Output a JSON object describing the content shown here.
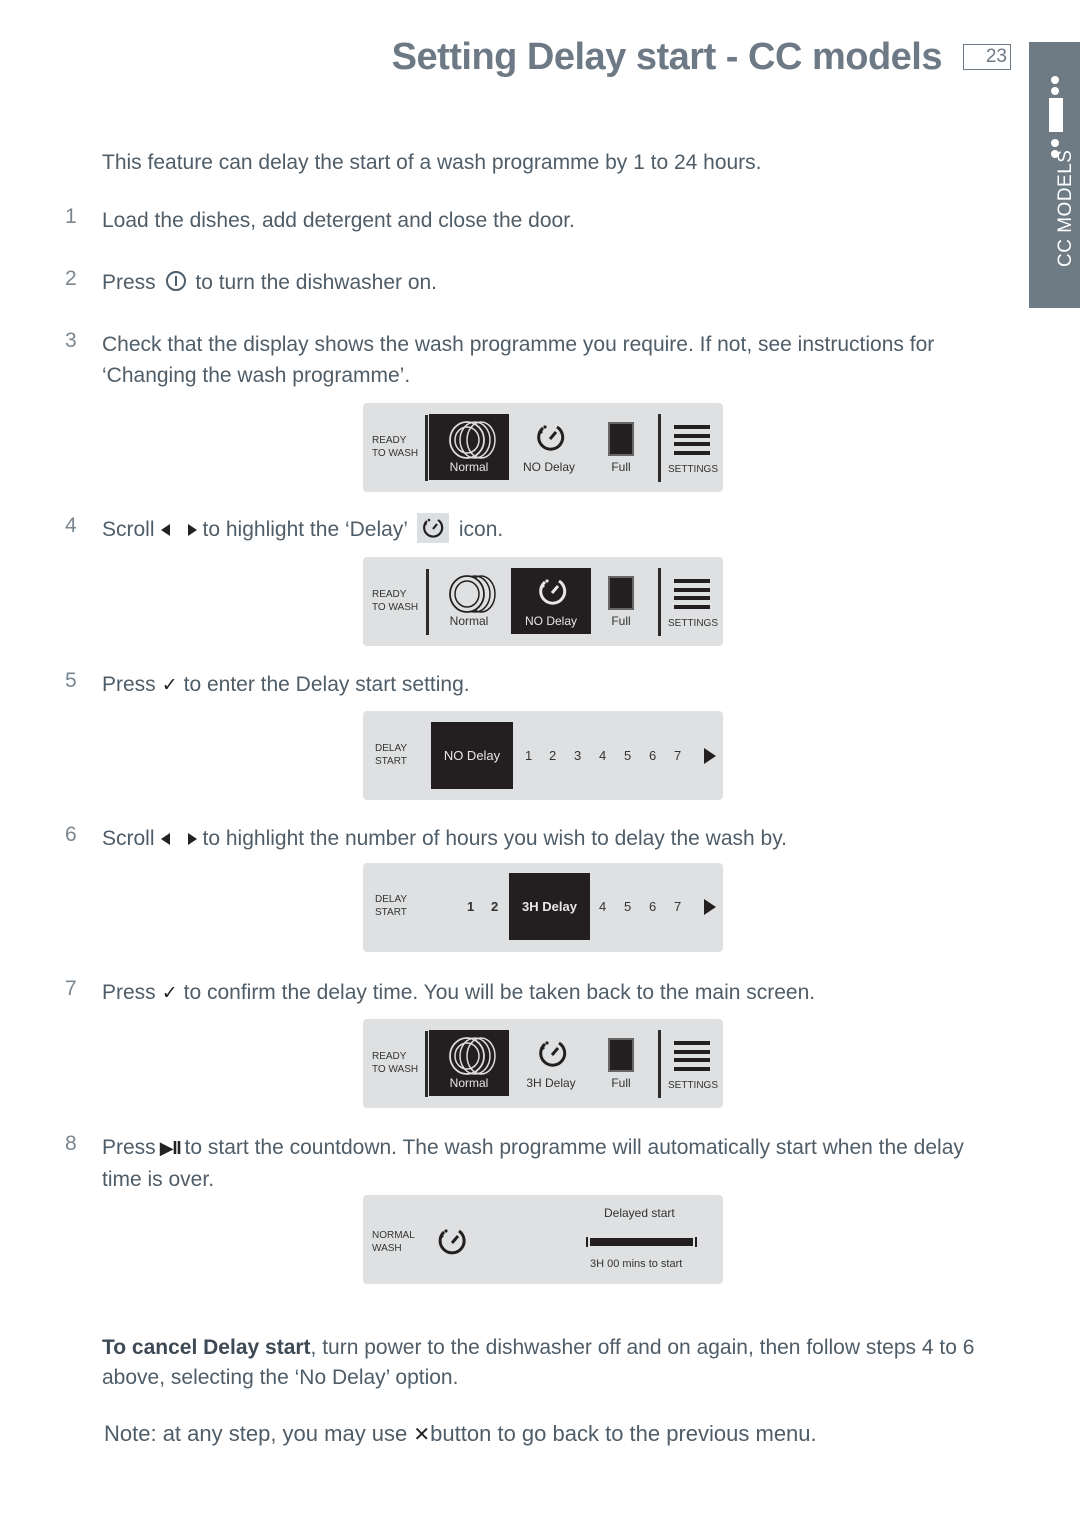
{
  "header": {
    "title": "Setting Delay start  - CC models",
    "page_number": "23",
    "side_tab_label": "CC MODELS"
  },
  "intro": "This feature can delay the start of a wash programme by 1 to 24 hours.",
  "steps": [
    {
      "num": "1",
      "text": "Load the dishes, add detergent and close the door."
    },
    {
      "num": "2",
      "before": "Press",
      "icon": "power-icon",
      "after": "to turn the dishwasher on."
    },
    {
      "num": "3",
      "text": "Check that the display shows the wash programme you require. If not, see instructions for",
      "text2": "‘Changing the wash programme’."
    },
    {
      "num": "4",
      "before": "Scroll",
      "icon": "left-right-arrows-icon",
      "after": "to highlight the ‘Delay’",
      "icon2": "delay-dial-icon",
      "after2": "icon."
    },
    {
      "num": "5",
      "before": "Press",
      "icon": "check-icon",
      "after": "to enter the Delay start setting."
    },
    {
      "num": "6",
      "before": "Scroll",
      "icon": "left-right-arrows-icon",
      "after": "to highlight the number of hours you wish to delay the wash by."
    },
    {
      "num": "7",
      "before": "Press",
      "icon": "check-icon",
      "after": "to confirm the delay time. You will be taken back to the main screen."
    },
    {
      "num": "8",
      "before": "Press",
      "icon": "play-pause-icon",
      "after": "to start the countdown. The wash programme will automatically start when the delay",
      "text2": "time is over."
    }
  ],
  "icons": {
    "check": "✓",
    "play_pause": "▶II",
    "x": "✕"
  },
  "panels": {
    "main1": {
      "status": [
        "READY",
        "TO WASH"
      ],
      "tiles": [
        "Normal",
        "NO Delay",
        "Full"
      ],
      "selected": "Normal",
      "settings": "SETTINGS"
    },
    "main2": {
      "status": [
        "READY",
        "TO WASH"
      ],
      "tiles": [
        "Normal",
        "NO Delay",
        "Full"
      ],
      "selected": "NO Delay",
      "settings": "SETTINGS"
    },
    "delay1": {
      "status": [
        "DELAY",
        "START"
      ],
      "selected": "NO Delay",
      "numbers": [
        "1",
        "2",
        "3",
        "4",
        "5",
        "6",
        "7"
      ]
    },
    "delay2": {
      "status": [
        "DELAY",
        "START"
      ],
      "before": [
        "1",
        "2"
      ],
      "selected": "3H Delay",
      "after": [
        "4",
        "5",
        "6",
        "7"
      ]
    },
    "main3": {
      "status": [
        "READY",
        "TO WASH"
      ],
      "tiles": [
        "Normal",
        "3H Delay",
        "Full"
      ],
      "selected": "Normal",
      "settings": "SETTINGS"
    },
    "countdown": {
      "status": [
        "NORMAL",
        "WASH"
      ],
      "heading": "Delayed start",
      "progress": 1.0,
      "remaining": "3H 00 mins to start"
    }
  },
  "cancel": {
    "bold": "To cancel Delay start",
    "rest": ", turn power to the dishwasher off and on again, then follow steps 4 to 6",
    "line2": "above, selecting the ‘No Delay’ option."
  },
  "note": {
    "before": "Note: at any step, you may use",
    "after": "button to go back to the previous menu."
  }
}
